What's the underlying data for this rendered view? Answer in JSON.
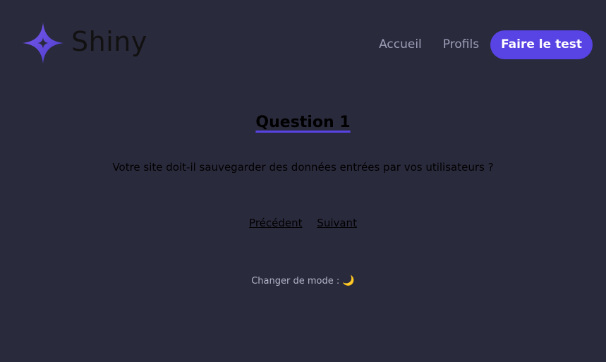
{
  "header": {
    "logo_text": "Shiny",
    "logo_icon": "star-icon",
    "nav": {
      "home": "Accueil",
      "profiles": "Profils",
      "cta": "Faire le test"
    }
  },
  "survey": {
    "title": "Question 1",
    "question": "Votre site doit-il sauvegarder des données entrées par vos utilisateurs ?",
    "previous": "Précédent",
    "next": "Suivant"
  },
  "footer": {
    "mode_label": "Changer de mode :",
    "mode_icon": "🌙"
  },
  "colors": {
    "background": "#2a2a3d",
    "accent": "#5843e4",
    "nav_text": "#9e9eb8"
  }
}
